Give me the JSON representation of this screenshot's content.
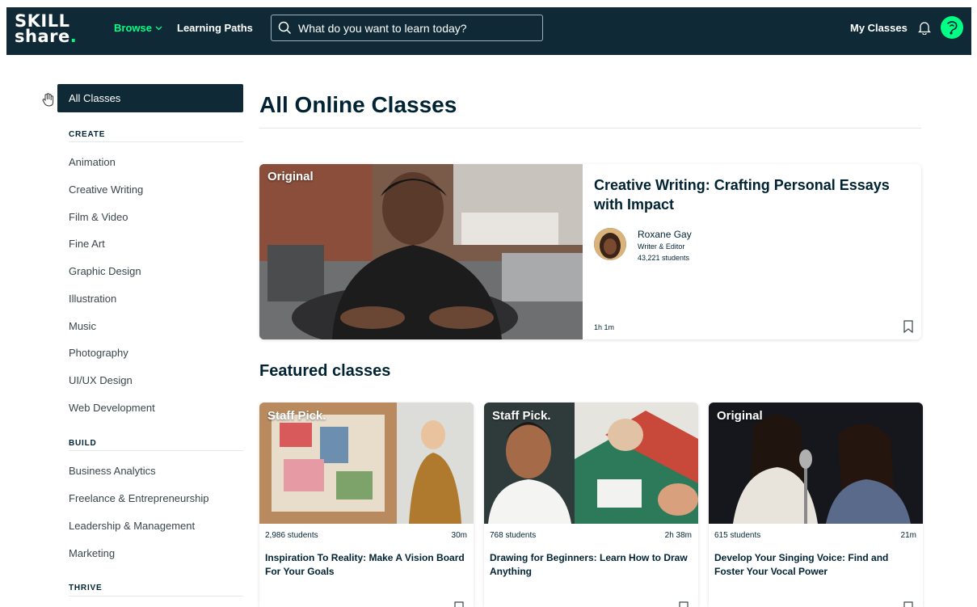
{
  "header": {
    "logo_line1": "SKILL",
    "logo_line2": "share",
    "logo_dot": ".",
    "browse_label": "Browse",
    "learning_paths_label": "Learning Paths",
    "search_placeholder": "What do you want to learn today?",
    "my_classes_label": "My Classes"
  },
  "sidebar": {
    "all_classes_label": "All Classes",
    "sections": [
      {
        "heading": "CREATE",
        "items": [
          "Animation",
          "Creative Writing",
          "Film & Video",
          "Fine Art",
          "Graphic Design",
          "Illustration",
          "Music",
          "Photography",
          "UI/UX Design",
          "Web Development"
        ]
      },
      {
        "heading": "BUILD",
        "items": [
          "Business Analytics",
          "Freelance & Entrepreneurship",
          "Leadership & Management",
          "Marketing"
        ]
      },
      {
        "heading": "THRIVE",
        "items": []
      }
    ]
  },
  "main": {
    "page_title": "All Online Classes",
    "hero": {
      "badge": "Original",
      "title": "Creative Writing: Crafting Personal Essays with Impact",
      "teacher": "Roxane Gay",
      "role": "Writer & Editor",
      "students": "43,221 students",
      "duration": "1h 1m"
    },
    "featured_title": "Featured classes",
    "cards": [
      {
        "badge": "Staff Pick.",
        "students": "2,986 students",
        "duration": "30m",
        "title": "Inspiration To Reality: Make A Vision Board For Your Goals"
      },
      {
        "badge": "Staff Pick.",
        "students": "768 students",
        "duration": "2h 38m",
        "title": "Drawing for Beginners: Learn How to Draw Anything"
      },
      {
        "badge": "Original",
        "students": "615 students",
        "duration": "21m",
        "title": "Develop Your Singing Voice: Find and Foster Your Vocal Power"
      }
    ]
  },
  "colors": {
    "nav_bg": "#0f2a36",
    "accent_green": "#00ff84",
    "text_dark": "#002333"
  },
  "icons": [
    "chevron-down-icon",
    "search-icon",
    "bell-icon",
    "user-avatar",
    "hand-pointer-icon",
    "bookmark-icon"
  ]
}
